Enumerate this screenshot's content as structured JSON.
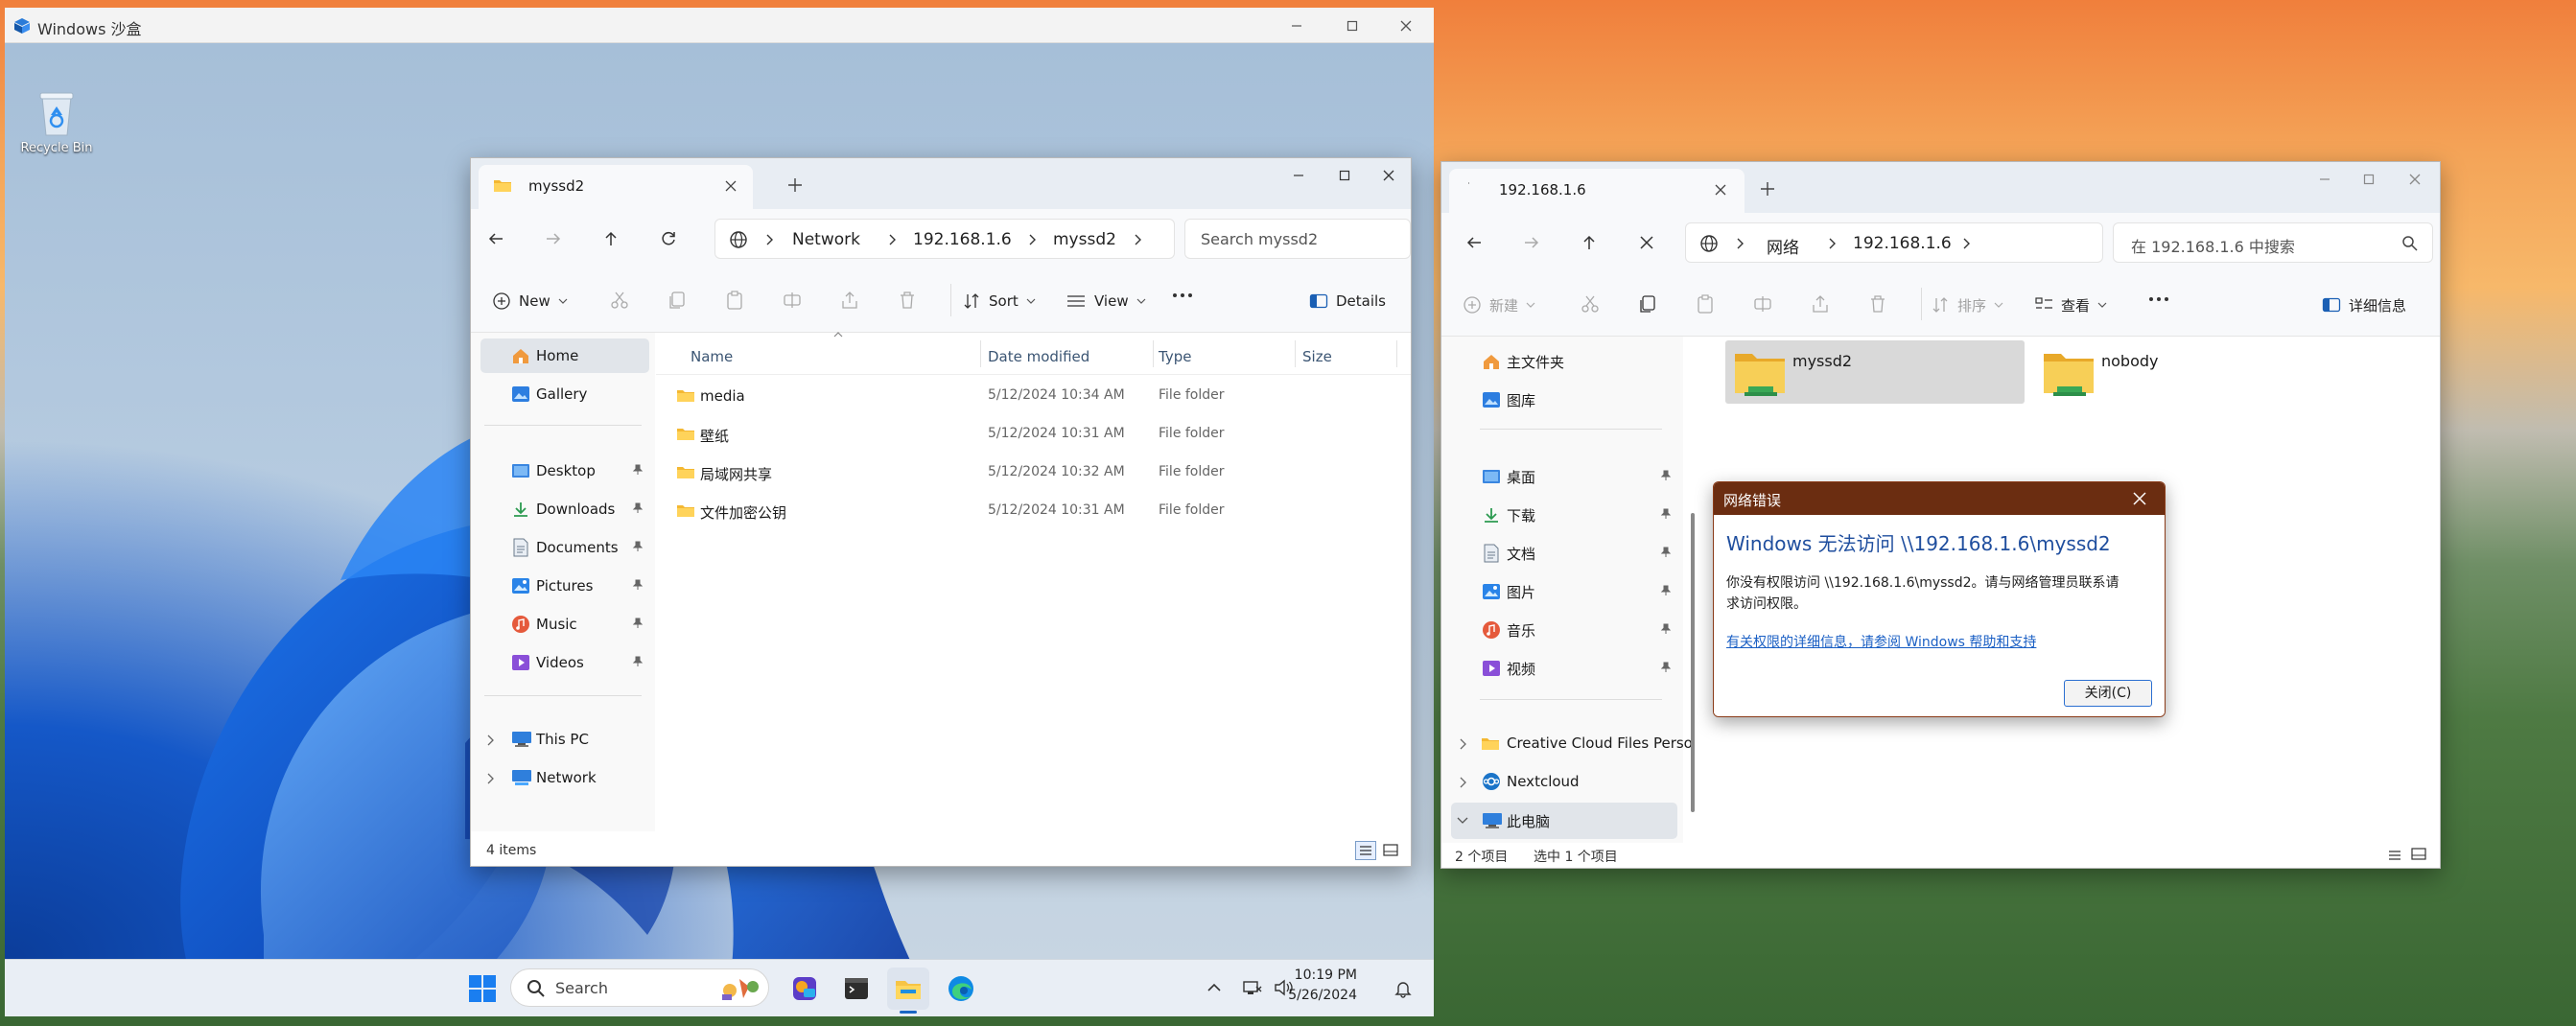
{
  "sandbox": {
    "title": "Windows 沙盒",
    "recycle_bin_label": "Recycle Bin",
    "taskbar": {
      "search_placeholder": "Search",
      "time": "10:19 PM",
      "date": "5/26/2024"
    }
  },
  "explorer_en": {
    "tab_title": "myssd2",
    "breadcrumbs": [
      "Network",
      "192.168.1.6",
      "myssd2"
    ],
    "search_placeholder": "Search myssd2",
    "commands": {
      "new": "New",
      "sort": "Sort",
      "view": "View",
      "details": "Details"
    },
    "nav_items": [
      {
        "label": "Home",
        "icon": "home-icon"
      },
      {
        "label": "Gallery",
        "icon": "gallery-icon"
      },
      {
        "label": "Desktop",
        "icon": "desktop-icon"
      },
      {
        "label": "Downloads",
        "icon": "download-icon"
      },
      {
        "label": "Documents",
        "icon": "documents-icon"
      },
      {
        "label": "Pictures",
        "icon": "pictures-icon"
      },
      {
        "label": "Music",
        "icon": "music-icon"
      },
      {
        "label": "Videos",
        "icon": "videos-icon"
      },
      {
        "label": "This PC",
        "icon": "pc-icon"
      },
      {
        "label": "Network",
        "icon": "network-icon"
      }
    ],
    "columns": [
      "Name",
      "Date modified",
      "Type",
      "Size"
    ],
    "files": [
      {
        "name": "media",
        "date": "5/12/2024 10:34 AM",
        "type": "File folder"
      },
      {
        "name": "壁纸",
        "date": "5/12/2024 10:31 AM",
        "type": "File folder"
      },
      {
        "name": "局域网共享",
        "date": "5/12/2024 10:32 AM",
        "type": "File folder"
      },
      {
        "name": "文件加密公钥",
        "date": "5/12/2024 10:31 AM",
        "type": "File folder"
      }
    ],
    "status": "4 items"
  },
  "explorer_cn": {
    "tab_title": "192.168.1.6",
    "breadcrumbs": [
      "网络",
      "192.168.1.6"
    ],
    "search_placeholder": "在 192.168.1.6 中搜索",
    "commands": {
      "new": "新建",
      "sort": "排序",
      "view": "查看",
      "details": "详细信息"
    },
    "nav_items": [
      {
        "label": "主文件夹",
        "icon": "home-icon"
      },
      {
        "label": "图库",
        "icon": "gallery-icon"
      },
      {
        "label": "桌面",
        "icon": "desktop-icon"
      },
      {
        "label": "下载",
        "icon": "download-icon"
      },
      {
        "label": "文档",
        "icon": "documents-icon"
      },
      {
        "label": "图片",
        "icon": "pictures-icon"
      },
      {
        "label": "音乐",
        "icon": "music-icon"
      },
      {
        "label": "视频",
        "icon": "videos-icon"
      },
      {
        "label": "Creative Cloud Files Personal",
        "icon": "folder-icon"
      },
      {
        "label": "Nextcloud",
        "icon": "nextcloud-icon"
      },
      {
        "label": "此电脑",
        "icon": "pc-icon"
      }
    ],
    "items": [
      {
        "name": "myssd2"
      },
      {
        "name": "nobody"
      }
    ],
    "status_count": "2 个项目",
    "status_selected": "选中 1 个项目"
  },
  "dialog": {
    "title": "网络错误",
    "heading": "Windows 无法访问 \\\\192.168.1.6\\myssd2",
    "message_line1": "你没有权限访问 \\\\192.168.1.6\\myssd2。请与网络管理员联系请",
    "message_line2": "求访问权限。",
    "link": "有关权限的详细信息，请参阅 Windows 帮助和支持",
    "close_button": "关闭(C)"
  }
}
